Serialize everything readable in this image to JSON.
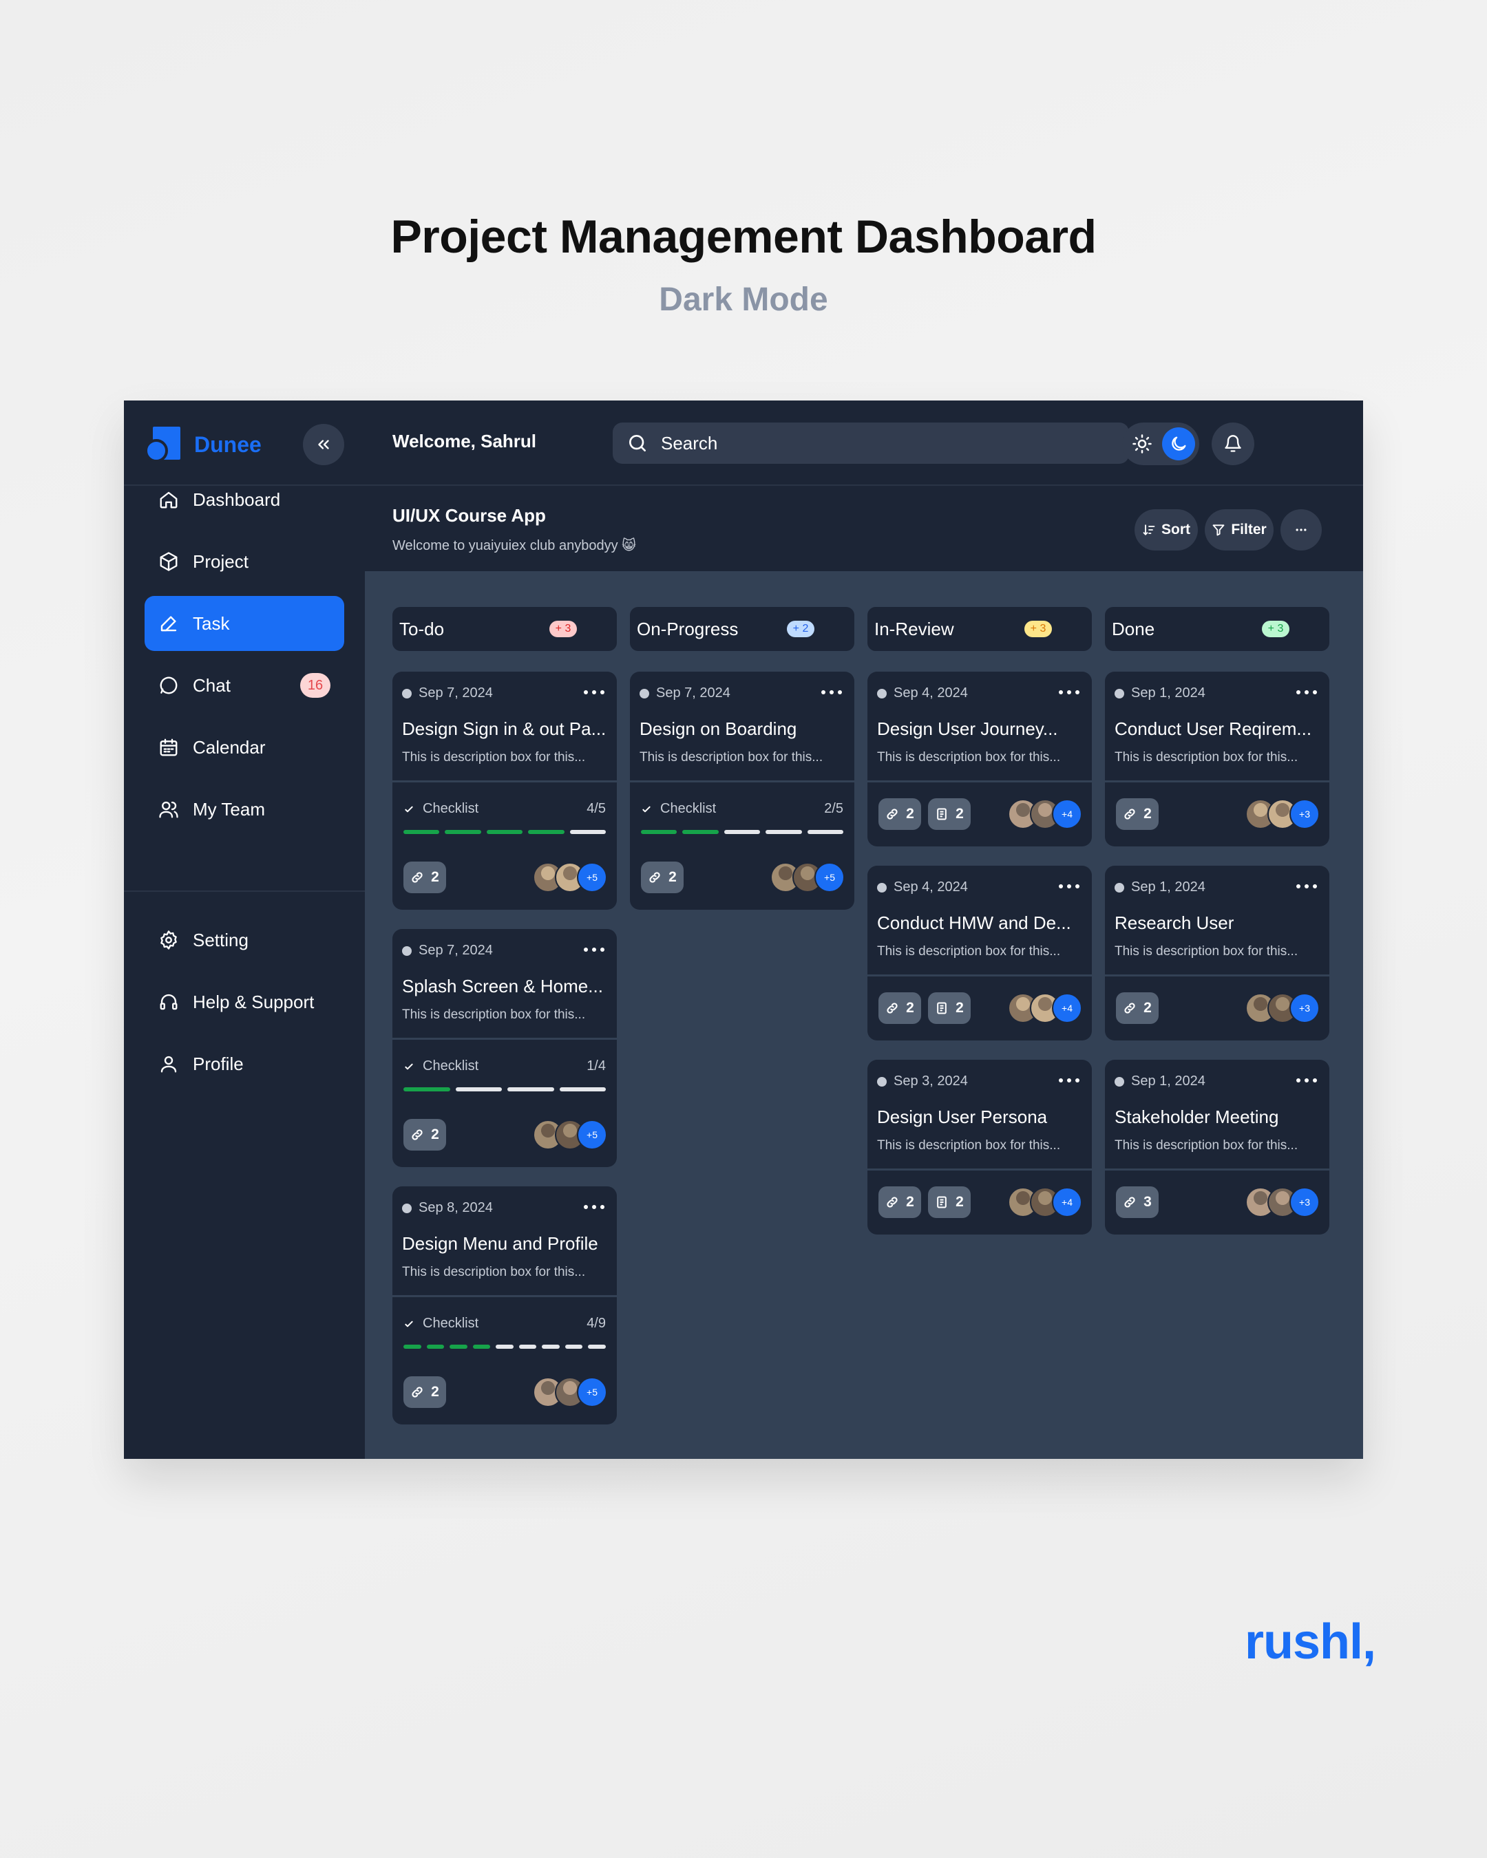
{
  "hero": {
    "title": "Project Management Dashboard",
    "subtitle": "Dark Mode"
  },
  "brand_mark": "rushl,",
  "app": {
    "logo": "Dunee",
    "welcome": "Welcome, Sahrul",
    "search": {
      "placeholder": "Search",
      "value": ""
    },
    "nav_primary": [
      {
        "label": "Dashboard",
        "icon": "home-icon",
        "active": false
      },
      {
        "label": "Project",
        "icon": "box-icon",
        "active": false
      },
      {
        "label": "Task",
        "icon": "pen-icon",
        "active": true
      },
      {
        "label": "Chat",
        "icon": "chat-icon",
        "active": false,
        "badge": "16"
      },
      {
        "label": "Calendar",
        "icon": "calendar-icon",
        "active": false
      },
      {
        "label": "My Team",
        "icon": "team-icon",
        "active": false
      }
    ],
    "nav_secondary": [
      {
        "label": "Setting",
        "icon": "gear-icon"
      },
      {
        "label": "Help & Support",
        "icon": "headset-icon"
      },
      {
        "label": "Profile",
        "icon": "user-icon"
      }
    ],
    "project": {
      "title": "UI/UX Course App",
      "subtitle": "Welcome to yuaiyuiex club anybodyy 😸"
    },
    "actions": {
      "sort": "Sort",
      "filter": "Filter"
    },
    "colors": {
      "accent": "#1a6ef5",
      "bg": "#1c2536",
      "board": "#334155",
      "progress_done": "#16a34a",
      "progress_todo": "#e5e7eb"
    },
    "columns": [
      {
        "title": "To-do",
        "count": "+ 3",
        "count_bg": "#fecaca",
        "count_fg": "#dc2626",
        "cards": [
          {
            "date": "Sep 7, 2024",
            "title": "Design Sign in & out Pa...",
            "desc": "This is description box for this...",
            "checklist": {
              "label": "Checklist",
              "count": "4/5",
              "done": 4,
              "total": 5
            },
            "links": "2",
            "more": "+5"
          },
          {
            "date": "Sep 7, 2024",
            "title": "Splash Screen & Home...",
            "desc": "This is description box for this...",
            "checklist": {
              "label": "Checklist",
              "count": "1/4",
              "done": 1,
              "total": 4
            },
            "links": "2",
            "more": "+5"
          },
          {
            "date": "Sep 8, 2024",
            "title": "Design Menu and Profile",
            "desc": "This is description box for this...",
            "checklist": {
              "label": "Checklist",
              "count": "4/9",
              "done": 4,
              "total": 9
            },
            "links": "2",
            "more": "+5"
          }
        ]
      },
      {
        "title": "On-Progress",
        "count": "+ 2",
        "count_bg": "#bfdbfe",
        "count_fg": "#2563eb",
        "cards": [
          {
            "date": "Sep 7, 2024",
            "title": "Design on Boarding",
            "desc": "This is description box for this...",
            "checklist": {
              "label": "Checklist",
              "count": "2/5",
              "done": 2,
              "total": 5
            },
            "links": "2",
            "more": "+5"
          }
        ]
      },
      {
        "title": "In-Review",
        "count": "+ 3",
        "count_bg": "#fde68a",
        "count_fg": "#d97706",
        "cards": [
          {
            "date": "Sep 4, 2024",
            "title": "Design User Journey...",
            "desc": "This is description box for this...",
            "links": "2",
            "docs": "2",
            "more": "+4"
          },
          {
            "date": "Sep 4, 2024",
            "title": "Conduct HMW and De...",
            "desc": "This is description box for this...",
            "links": "2",
            "docs": "2",
            "more": "+4"
          },
          {
            "date": "Sep 3, 2024",
            "title": "Design User Persona",
            "desc": "This is description box for this...",
            "links": "2",
            "docs": "2",
            "more": "+4"
          }
        ]
      },
      {
        "title": "Done",
        "count": "+ 3",
        "count_bg": "#bbf7d0",
        "count_fg": "#16a34a",
        "cards": [
          {
            "date": "Sep 1, 2024",
            "title": "Conduct User Reqirem...",
            "desc": "This is description box for this...",
            "links": "2",
            "more": "+3"
          },
          {
            "date": "Sep 1, 2024",
            "title": "Research User",
            "desc": "This is description box for this...",
            "links": "2",
            "more": "+3"
          },
          {
            "date": "Sep 1, 2024",
            "title": "Stakeholder Meeting",
            "desc": "This is description box for this...",
            "links": "3",
            "more": "+3"
          }
        ]
      }
    ]
  }
}
